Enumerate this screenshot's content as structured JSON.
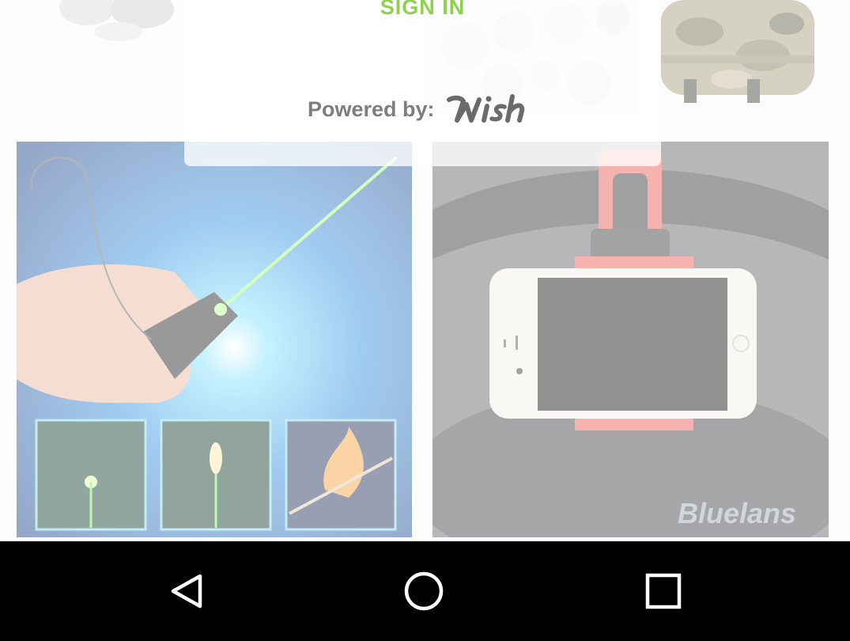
{
  "signin": {
    "title": "SIGN IN"
  },
  "powered_by": {
    "label": "Powered by:",
    "logo_text": "wish"
  },
  "products": [
    {
      "name": "earbuds",
      "image_text": ""
    },
    {
      "name": "accessory-pack",
      "image_text": ""
    },
    {
      "name": "camo-backpack",
      "image_text": ""
    },
    {
      "name": "green-laser-pointer",
      "image_text": ""
    },
    {
      "name": "steering-wheel-phone-holder",
      "watermark": "Bluelans"
    }
  ],
  "navbar": {
    "back_icon": "triangle-back-icon",
    "home_icon": "circle-home-icon",
    "recent_icon": "square-recent-icon"
  },
  "colors": {
    "signin_green": "#8ed14f",
    "powered_gray": "#7e7e7e",
    "navbar_bg": "#000000"
  }
}
